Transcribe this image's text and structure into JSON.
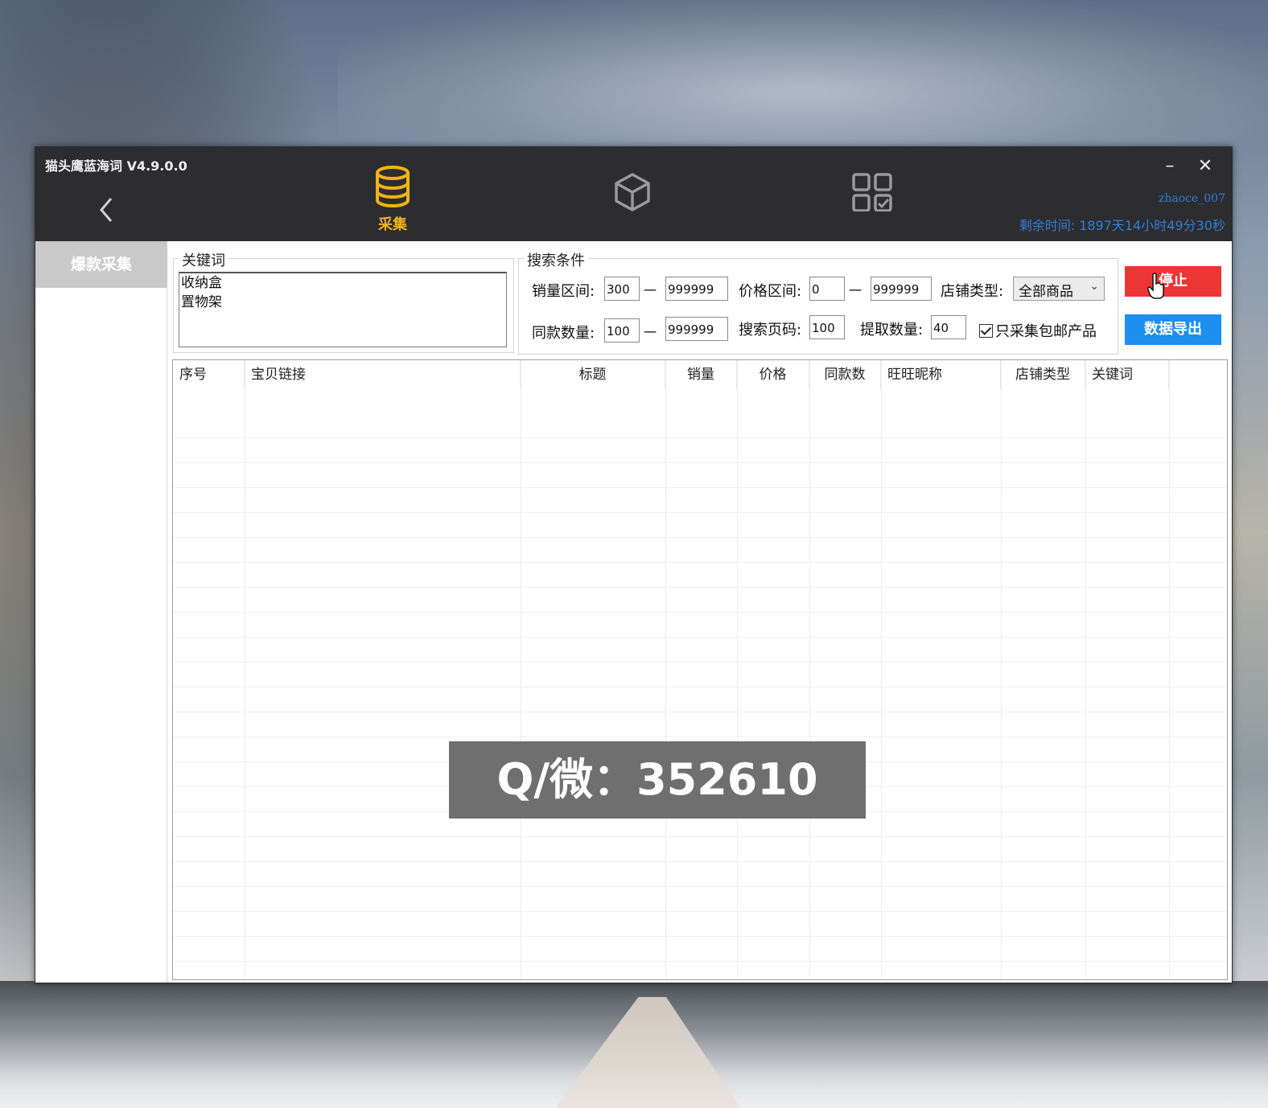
{
  "app": {
    "title": "猫头鹰蓝海词 V4.9.0.0",
    "minimize_glyph": "–",
    "close_glyph": "✕"
  },
  "nav": {
    "tabs": [
      {
        "label": "采集",
        "icon": "database-icon",
        "active": true
      },
      {
        "label": "",
        "icon": "box-icon",
        "active": false
      },
      {
        "label": "",
        "icon": "grid-check-icon",
        "active": false
      }
    ]
  },
  "user": {
    "name": "zhaoce_007",
    "remaining_label": "剩余时间:",
    "remaining_value": "1897天14小时49分30秒"
  },
  "sidebar": {
    "items": [
      {
        "label": "爆款采集",
        "active": true
      }
    ]
  },
  "keywords": {
    "legend": "关键词",
    "value": "收纳盒\n置物架"
  },
  "conditions": {
    "legend": "搜索条件",
    "sales_label": "销量区间:",
    "sales_min": "300",
    "sales_max": "999999",
    "price_label": "价格区间:",
    "price_min": "0",
    "price_max": "999999",
    "shop_type_label": "店铺类型:",
    "shop_type_value": "全部商品",
    "same_label": "同款数量:",
    "same_min": "100",
    "same_max": "999999",
    "page_label": "搜索页码:",
    "page_value": "100",
    "extract_label": "提取数量:",
    "extract_value": "40",
    "free_shipping_label": "只采集包邮产品",
    "free_shipping_checked": true,
    "dash": "一"
  },
  "buttons": {
    "stop": "停止",
    "export": "数据导出"
  },
  "table": {
    "columns": [
      "序号",
      "宝贝链接",
      "标题",
      "销量",
      "价格",
      "同款数",
      "旺旺昵称",
      "店铺类型",
      "关键词"
    ],
    "rows": []
  },
  "watermark": {
    "text": "Q/微：352610"
  },
  "colors": {
    "accent_yellow": "#f1b318",
    "stop_red": "#ec3636",
    "export_blue": "#1c8ff0",
    "titlebar": "#2d2d2f",
    "user_blue": "#2f7fd8"
  }
}
